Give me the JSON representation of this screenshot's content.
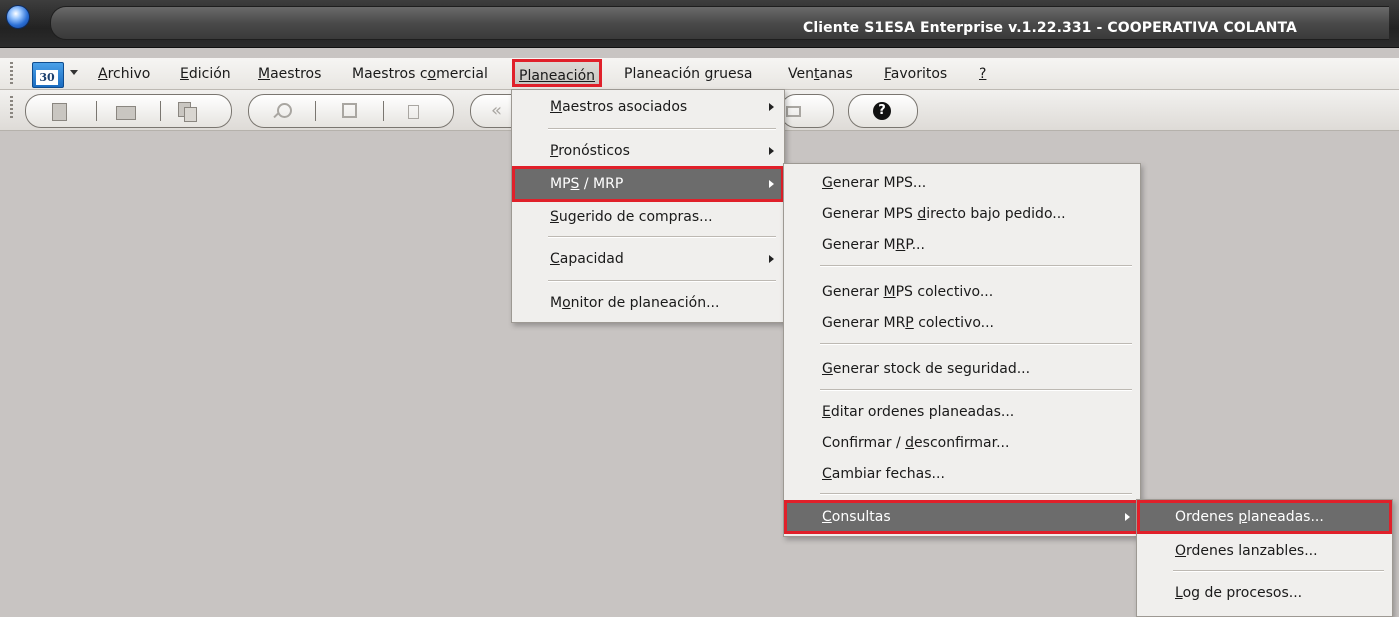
{
  "window": {
    "title": "Cliente S1ESA Enterprise v.1.22.331 - COOPERATIVA COLANTA"
  },
  "menubar": {
    "calendar_day": "30",
    "items": [
      "Archivo",
      "Edición",
      "Maestros",
      "Maestros comercial",
      "Planeación",
      "Planeación gruesa",
      "Ventanas",
      "Favoritos",
      "?"
    ]
  },
  "planeacion_menu": {
    "items": [
      "Maestros asociados",
      "Pronósticos",
      "MPS / MRP",
      "Sugerido de compras...",
      "Capacidad",
      "Monitor de planeación..."
    ]
  },
  "mps_mrp_menu": {
    "items": [
      "Generar MPS...",
      "Generar MPS directo bajo pedido...",
      "Generar MRP...",
      "Generar MPS colectivo...",
      "Generar MRP colectivo...",
      "Generar stock de seguridad...",
      "Editar ordenes planeadas...",
      "Confirmar / desconfirmar...",
      "Cambiar fechas...",
      "Consultas"
    ]
  },
  "consultas_menu": {
    "items": [
      "Ordenes planeadas...",
      "Ordenes lanzables...",
      "Log de procesos..."
    ]
  },
  "icons": [
    "app-orb-icon",
    "calendar-icon",
    "new-document-icon",
    "open-folder-icon",
    "copy-icon",
    "search-icon",
    "save-icon",
    "delete-icon",
    "back-icon",
    "print-icon",
    "help-icon"
  ],
  "colors": {
    "highlight": "#6c6c6c",
    "callout": "#e0202a",
    "titlebar": "#2c2c2c"
  }
}
